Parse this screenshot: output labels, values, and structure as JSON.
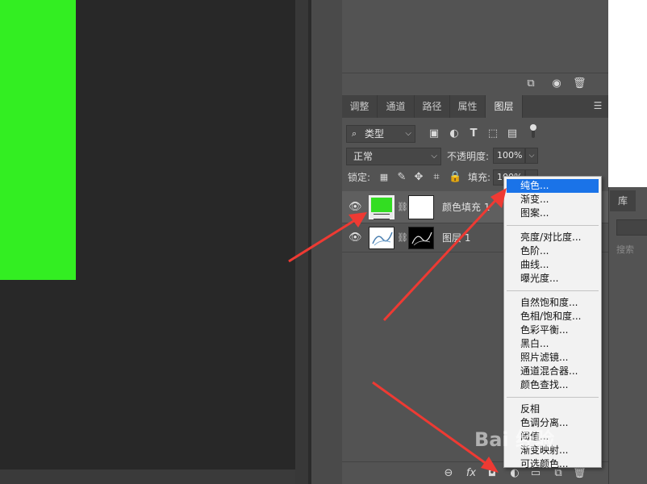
{
  "colors": {
    "canvas_fill": "#33ee22",
    "layer_fill_thumb": "#33dd22",
    "menu_highlight": "#1a73e8",
    "arrow": "#ee3a33"
  },
  "layers_panel": {
    "tabs": [
      {
        "label": "调整",
        "active": false
      },
      {
        "label": "通道",
        "active": false
      },
      {
        "label": "路径",
        "active": false
      },
      {
        "label": "属性",
        "active": false
      },
      {
        "label": "图层",
        "active": true
      }
    ],
    "filter": {
      "label": "类型",
      "icon": "search-icon"
    },
    "blend_mode": "正常",
    "opacity_label": "不透明度:",
    "opacity_value": "100%",
    "lock_label": "锁定:",
    "fill_label": "填充:",
    "fill_value": "100%",
    "layers": [
      {
        "name": "颜色填充 1",
        "selected": true
      },
      {
        "name": "图层 1",
        "selected": false
      }
    ]
  },
  "library_panel": {
    "tab": "库",
    "search_placeholder": "搜索"
  },
  "context_menu": {
    "groups": [
      [
        "纯色...",
        "渐变...",
        "图案..."
      ],
      [
        "亮度/对比度...",
        "色阶...",
        "曲线...",
        "曝光度..."
      ],
      [
        "自然饱和度...",
        "色相/饱和度...",
        "色彩平衡...",
        "黑白...",
        "照片滤镜...",
        "通道混合器...",
        "颜色查找..."
      ],
      [
        "反相",
        "色调分离...",
        "阈值...",
        "渐变映射...",
        "可选颜色..."
      ]
    ],
    "highlighted": "纯色..."
  },
  "bottom_toolbar": {
    "fx_label": "fx",
    "icons": [
      "link-icon",
      "fx-icon",
      "mask-icon",
      "adjustment-icon",
      "folder-icon",
      "new-layer-icon",
      "trash-icon"
    ]
  },
  "watermark": "Bai 经验"
}
